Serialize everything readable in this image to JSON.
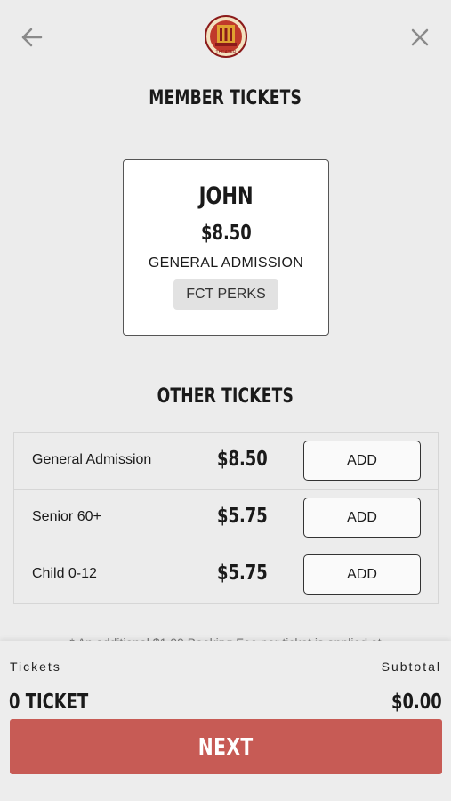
{
  "header": {
    "back_icon": "arrow-left-icon",
    "close_icon": "close-icon",
    "logo": "theater-logo",
    "logo_text": "THEATER"
  },
  "member_section": {
    "title": "MEMBER TICKETS",
    "card": {
      "name": "JOHN",
      "price": "$8.50",
      "type": "GENERAL ADMISSION",
      "badge": "FCT PERKS"
    }
  },
  "other_section": {
    "title": "OTHER TICKETS",
    "tickets": [
      {
        "name": "General Admission",
        "price": "$8.50",
        "button": "ADD"
      },
      {
        "name": "Senior 60+",
        "price": "$5.75",
        "button": "ADD"
      },
      {
        "name": "Child 0-12",
        "price": "$5.75",
        "button": "ADD"
      }
    ]
  },
  "fee_note": "* An additional $1.00 Booking Fee per ticket is applied at",
  "footer": {
    "tickets_label": "Tickets",
    "subtotal_label": "Subtotal",
    "ticket_count": "0 TICKET",
    "subtotal": "$0.00",
    "next_label": "NEXT"
  },
  "colors": {
    "background": "#ececec",
    "accent": "#c75b55",
    "logo_red": "#c0392b",
    "logo_gold": "#e0a030"
  }
}
